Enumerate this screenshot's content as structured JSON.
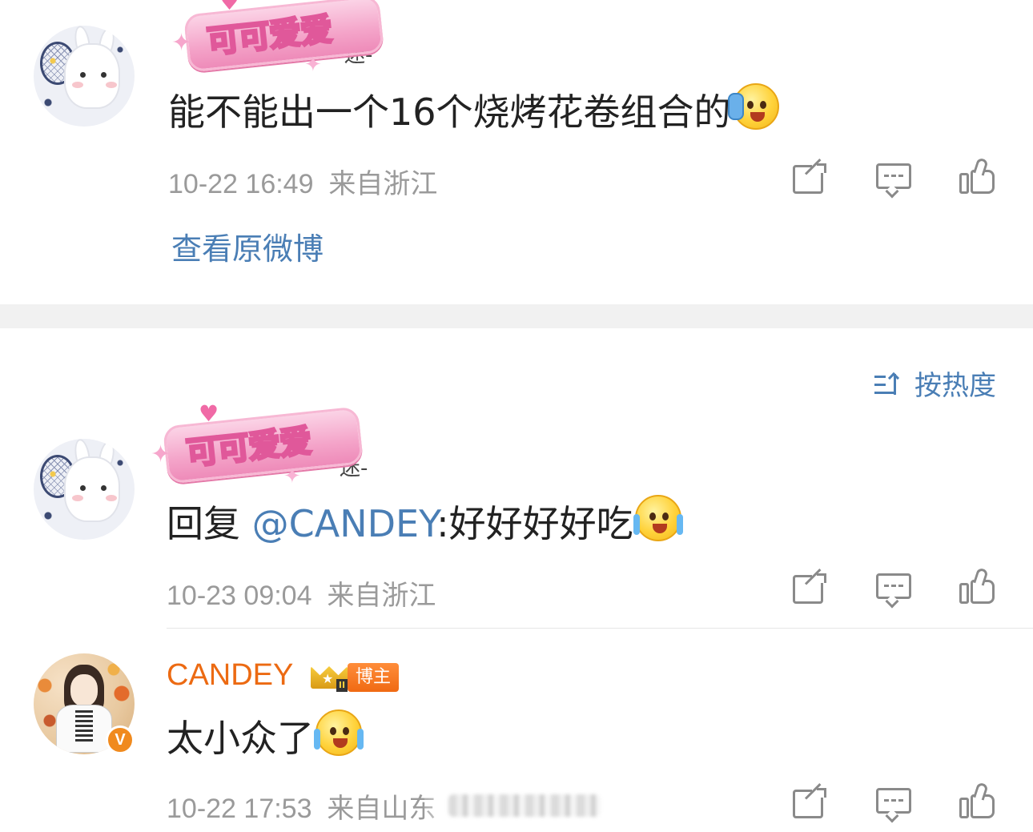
{
  "comments": [
    {
      "id": "c1",
      "username_partial": "迷-",
      "sticker_text": "可可爱爱",
      "text": "能不能出一个16个烧烤花卷组合的",
      "emoji": "thinking-sweat-emoji",
      "date": "10-22 16:49",
      "location": "来自浙江"
    }
  ],
  "view_original": "查看原微博",
  "sort": {
    "label": "按热度",
    "icon": "sort-by-hot-icon"
  },
  "replies": [
    {
      "id": "r1",
      "username_partial": "迷-",
      "sticker_text": "可可爱爱",
      "reply_prefix": "回复 ",
      "mention": "@CANDEY",
      "text": ":好好好好吃",
      "emoji": "laugh-cry-emoji",
      "date": "10-23 09:04",
      "location": "来自浙江"
    },
    {
      "id": "r2",
      "username": "CANDEY",
      "badge": "博主",
      "text": "太小众了",
      "emoji": "tears-of-joy-emoji",
      "date": "10-22 17:53",
      "location": "来自山东"
    }
  ],
  "colors": {
    "link_blue": "#4a7eb5",
    "meta_gray": "#9a9a9a",
    "username_orange": "#ec6a12",
    "separator": "#f1f1f1"
  }
}
